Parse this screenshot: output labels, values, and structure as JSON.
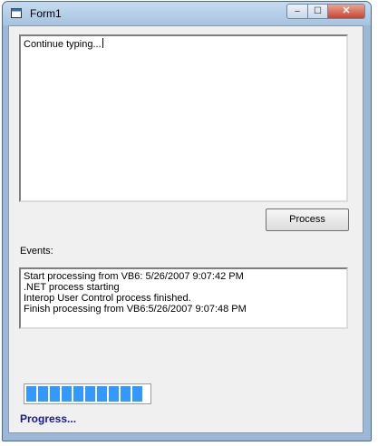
{
  "window": {
    "title": "Form1",
    "controls": {
      "minimize": "–",
      "maximize": "☐",
      "close": "✕"
    }
  },
  "input": {
    "value": "Continue typing..."
  },
  "process_button": {
    "label": "Process"
  },
  "events": {
    "label": "Events:",
    "lines": [
      "Start processing from VB6: 5/26/2007 9:07:42 PM",
      ".NET process starting",
      "Interop User Control process finished.",
      "Finish processing from VB6:5/26/2007 9:07:48 PM"
    ]
  },
  "progress": {
    "label": "Progress...",
    "segments_filled": 10,
    "color": "#3399ff"
  }
}
